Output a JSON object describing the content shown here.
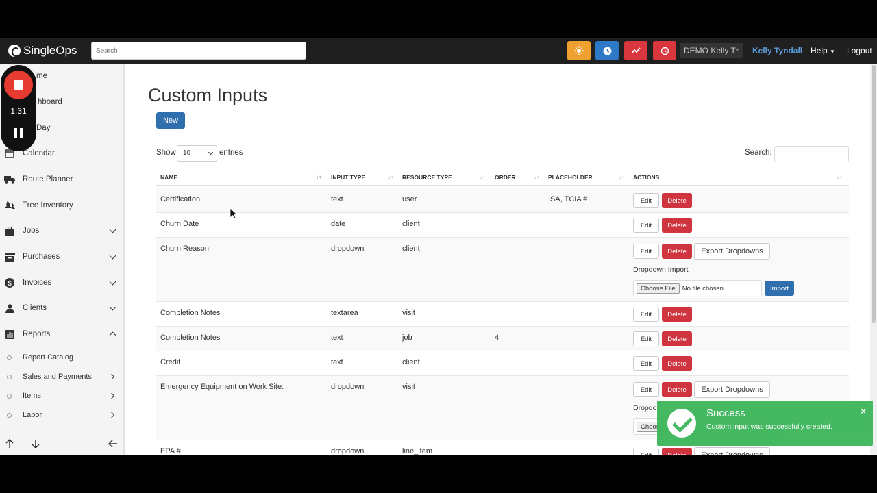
{
  "app": {
    "brand": "SingleOps"
  },
  "topbar": {
    "search_placeholder": "Search",
    "demo_select": "DEMO Kelly T",
    "user": "Kelly Tyndall",
    "help": "Help",
    "logout": "Logout",
    "colors": {
      "sun": "#f0a030",
      "clock": "#2d79c7",
      "chart": "#d9363e",
      "history": "#d9363e"
    }
  },
  "recorder": {
    "time": "1:31"
  },
  "sidebar": {
    "items": [
      {
        "label": "me"
      },
      {
        "label": "hboard"
      },
      {
        "label": "Day"
      },
      {
        "label": "Calendar"
      },
      {
        "label": "Route Planner"
      },
      {
        "label": "Tree Inventory"
      },
      {
        "label": "Jobs"
      },
      {
        "label": "Purchases"
      },
      {
        "label": "Invoices"
      },
      {
        "label": "Clients"
      },
      {
        "label": "Reports"
      }
    ],
    "subitems": [
      {
        "label": "Report Catalog"
      },
      {
        "label": "Sales and Payments"
      },
      {
        "label": "Items"
      },
      {
        "label": "Labor"
      }
    ]
  },
  "main": {
    "title": "Custom Inputs",
    "new_button": "New",
    "show": "Show",
    "entries_value": "10",
    "entries": "entries",
    "search_label": "Search:",
    "columns": [
      "Name",
      "Input Type",
      "Resource Type",
      "Order",
      "Placeholder",
      "Actions"
    ],
    "edit": "Edit",
    "delete": "Delete",
    "export": "Export Dropdowns",
    "dropdown_import": "Dropdown Import",
    "choose_file": "Choose File",
    "no_file": "No file chosen",
    "import": "Import",
    "rows": [
      {
        "name": "Certification",
        "input_type": "text",
        "resource_type": "user",
        "order": "",
        "placeholder": "ISA, TCIA #"
      },
      {
        "name": "Churn Date",
        "input_type": "date",
        "resource_type": "client",
        "order": "",
        "placeholder": ""
      },
      {
        "name": "Churn Reason",
        "input_type": "dropdown",
        "resource_type": "client",
        "order": "",
        "placeholder": ""
      },
      {
        "name": "Completion Notes",
        "input_type": "textarea",
        "resource_type": "visit",
        "order": "",
        "placeholder": ""
      },
      {
        "name": "Completion Notes",
        "input_type": "text",
        "resource_type": "job",
        "order": "4",
        "placeholder": ""
      },
      {
        "name": "Credit",
        "input_type": "text",
        "resource_type": "client",
        "order": "",
        "placeholder": ""
      },
      {
        "name": "Emergency Equipment on Work Site:",
        "input_type": "dropdown",
        "resource_type": "visit",
        "order": "",
        "placeholder": ""
      },
      {
        "name": "EPA #",
        "input_type": "dropdown",
        "resource_type": "line_item",
        "order": "",
        "placeholder": ""
      }
    ],
    "partial_label": "Dropdo",
    "partial_file": "Choos"
  },
  "toast": {
    "title": "Success",
    "message": "Custom input was successfully created.",
    "close": "×"
  }
}
